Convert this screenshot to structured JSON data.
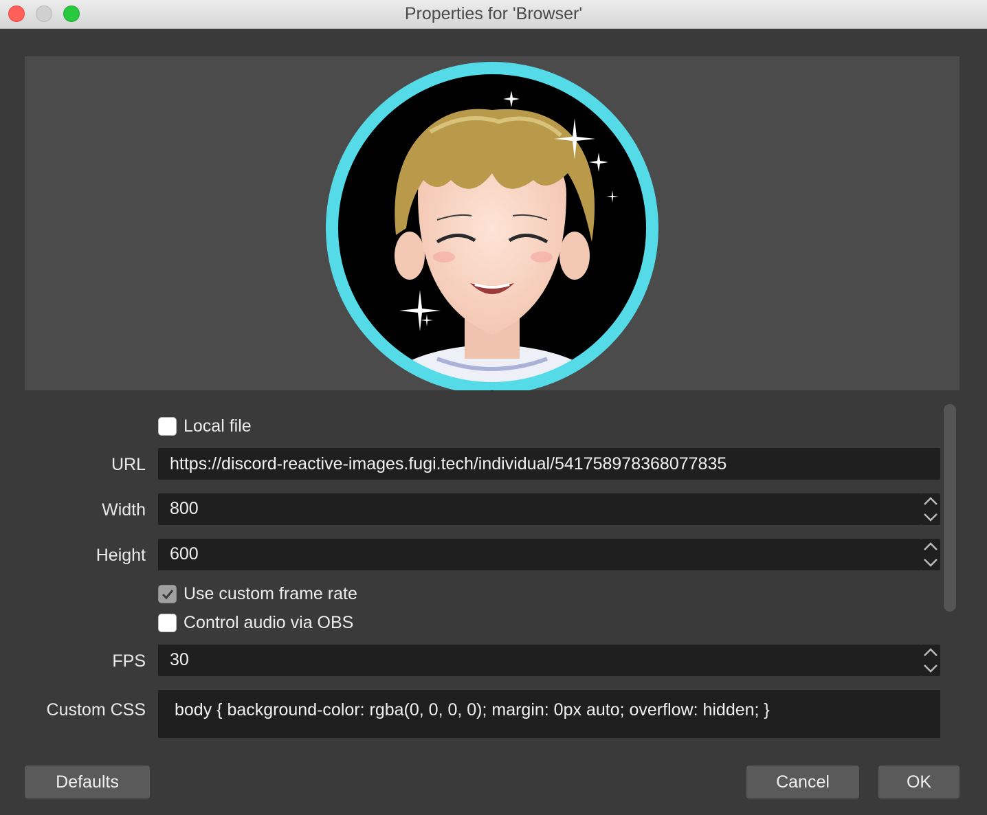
{
  "window": {
    "title": "Properties for 'Browser'"
  },
  "preview": {
    "image": "avatar-anime-character",
    "ring_color": "#55dbe8"
  },
  "form": {
    "local_file": {
      "label": "Local file",
      "checked": false
    },
    "url": {
      "label": "URL",
      "value": "https://discord-reactive-images.fugi.tech/individual/541758978368077835"
    },
    "width": {
      "label": "Width",
      "value": "800"
    },
    "height": {
      "label": "Height",
      "value": "600"
    },
    "custom_frame_rate": {
      "label": "Use custom frame rate",
      "checked": true
    },
    "control_audio": {
      "label": "Control audio via OBS",
      "checked": false
    },
    "fps": {
      "label": "FPS",
      "value": "30"
    },
    "custom_css": {
      "label": "Custom CSS",
      "value": "body { background-color: rgba(0, 0, 0, 0); margin: 0px auto; overflow: hidden; }"
    }
  },
  "buttons": {
    "defaults": "Defaults",
    "cancel": "Cancel",
    "ok": "OK"
  }
}
